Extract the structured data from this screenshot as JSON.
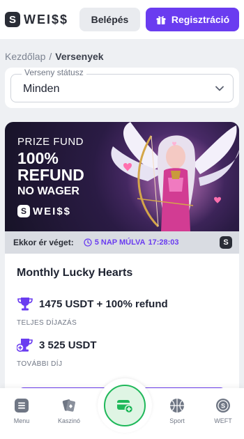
{
  "header": {
    "logo_mark": "S",
    "logo_text": "WEI$$",
    "login_label": "Belépés",
    "register_label": "Regisztráció",
    "register_color": "#6a3cf0"
  },
  "breadcrumb": {
    "home": "Kezdőlap",
    "separator": "/",
    "current": "Versenyek"
  },
  "filter": {
    "legend": "Verseny státusz",
    "value": "Minden"
  },
  "tournament": {
    "banner": {
      "prize_fund": "PRIZE FUND",
      "line1": "100%",
      "line2": "REFUND",
      "line3": "NO WAGER",
      "logo_text": "WEI$$"
    },
    "status": {
      "label": "Ekkor ér véget:",
      "countdown": "5 NAP MÚLVA",
      "time": "17:28:03"
    },
    "title": "Monthly Lucky Hearts",
    "prizes": [
      {
        "amount": "1475 USDT + 100% refund",
        "label": "TELJES DÍJAZÁS"
      },
      {
        "amount": "3 525 USDT",
        "label": "TOVÁBBI DÍJ"
      }
    ]
  },
  "bottom_nav": {
    "items": [
      {
        "label": "Menu",
        "icon": "menu-icon"
      },
      {
        "label": "Kaszinó",
        "icon": "cards-icon"
      },
      {
        "label": "",
        "icon": "wallet-add-icon"
      },
      {
        "label": "Sport",
        "icon": "basketball-icon"
      },
      {
        "label": "WEFT",
        "icon": "coin-icon"
      }
    ],
    "accent_color": "#1fb85a"
  }
}
